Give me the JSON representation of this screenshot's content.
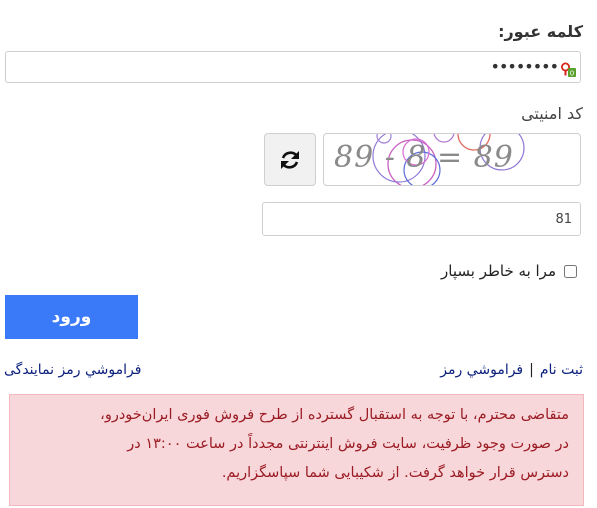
{
  "password": {
    "label": "کلمه عبور:",
    "masked_value": "••••••••",
    "manager_badge": "0"
  },
  "captcha": {
    "label": "کد امنیتی",
    "image_text": "89 - 8 = 89",
    "input_value": "81"
  },
  "remember_me": {
    "label": "مرا به خاطر بسپار",
    "checked": false
  },
  "login_button": {
    "label": "ورود",
    "color": "#3a79f7"
  },
  "links": {
    "register": "ثبت نام",
    "separator": "|",
    "forgot_password": "فراموشي رمز",
    "forgot_dealer_password": "فراموشي رمز نمايندگی"
  },
  "alert": {
    "lines": [
      "متقاضی محترم، با توجه به استقبال گسترده از طرح فروش فوری ایران‌خودرو،",
      "در صورت وجود ظرفیت، سایت فروش اینترنتی مجدداً در ساعت ۱۳:۰۰ در",
      "دسترس قرار خواهد گرفت. از شکیبایی شما سپاسگزاریم."
    ],
    "background": "#f8d7da",
    "text_color": "#9b1c24"
  },
  "icons": {
    "refresh": "refresh-icon",
    "password_manager": "password-manager-icon"
  }
}
